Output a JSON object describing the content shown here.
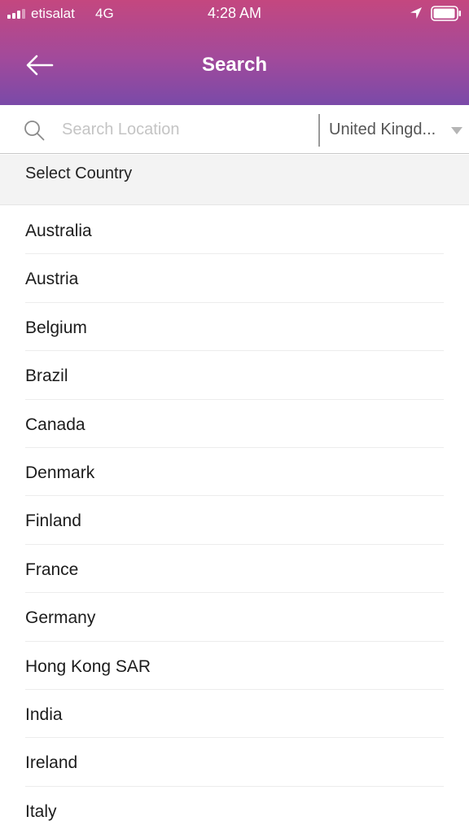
{
  "status_bar": {
    "carrier": "etisalat",
    "network": "4G",
    "time": "4:28 AM"
  },
  "header": {
    "title": "Search",
    "gradient_top": "#c4477f",
    "gradient_bottom": "#7a4aa8"
  },
  "search": {
    "placeholder": "Search Location",
    "value": "",
    "country_selected": "United Kingd..."
  },
  "country_section": {
    "title": "Select Country",
    "countries": [
      "Australia",
      "Austria",
      "Belgium",
      "Brazil",
      "Canada",
      "Denmark",
      "Finland",
      "France",
      "Germany",
      "Hong Kong SAR",
      "India",
      "Ireland",
      "Italy"
    ]
  },
  "icons": {
    "back": "arrow-left-icon",
    "search": "magnifier-icon",
    "dropdown": "caret-down-icon",
    "location": "location-arrow-icon",
    "battery": "battery-icon",
    "signal": "signal-icon"
  }
}
